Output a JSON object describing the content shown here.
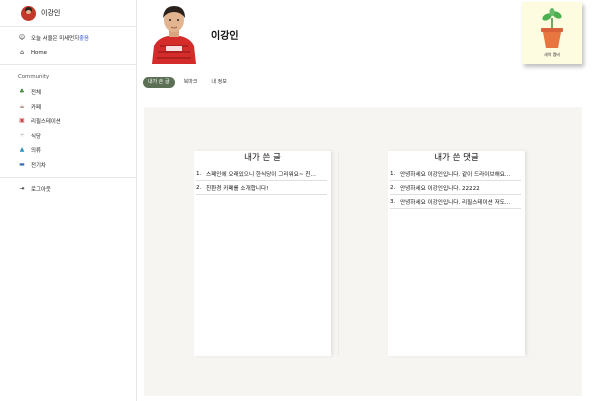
{
  "sidebar": {
    "profile_name": "이강인",
    "weather": {
      "prefix": "오늘 서울은 미세먼지 ",
      "status": "좋음"
    },
    "home_label": "Home",
    "section_title": "Community",
    "items": [
      {
        "label": "전체",
        "icon": "tree-icon"
      },
      {
        "label": "카페",
        "icon": "coffee-icon"
      },
      {
        "label": "리필스테이션",
        "icon": "refill-icon"
      },
      {
        "label": "식당",
        "icon": "fork-icon"
      },
      {
        "label": "의류",
        "icon": "shirt-icon"
      },
      {
        "label": "전기차",
        "icon": "car-icon"
      }
    ],
    "logout_label": "로그아웃"
  },
  "header": {
    "name": "이강인",
    "tabs": [
      {
        "label": "내가 쓴 글",
        "active": true
      },
      {
        "label": "북마크",
        "active": false
      },
      {
        "label": "내 정보",
        "active": false
      }
    ]
  },
  "plant_card": {
    "label": "새싹 멤버"
  },
  "posts": {
    "title": "내가 쓴 글",
    "items": [
      {
        "num": "1.",
        "text": "스페인에 오래있으니 한식당이 그리워요~ 친…"
      },
      {
        "num": "2.",
        "text": "친환경 카페를 소개합니다!"
      }
    ]
  },
  "comments": {
    "title": "내가 쓴 댓글",
    "items": [
      {
        "num": "1.",
        "text": "안녕하세요 이강인입니다. 같이 드라이브해요…"
      },
      {
        "num": "2.",
        "text": "안녕하세요 이강인입니다. 22222"
      },
      {
        "num": "3.",
        "text": "안녕하세요 이강인입니다. 리필스테이션 저도…"
      }
    ]
  }
}
